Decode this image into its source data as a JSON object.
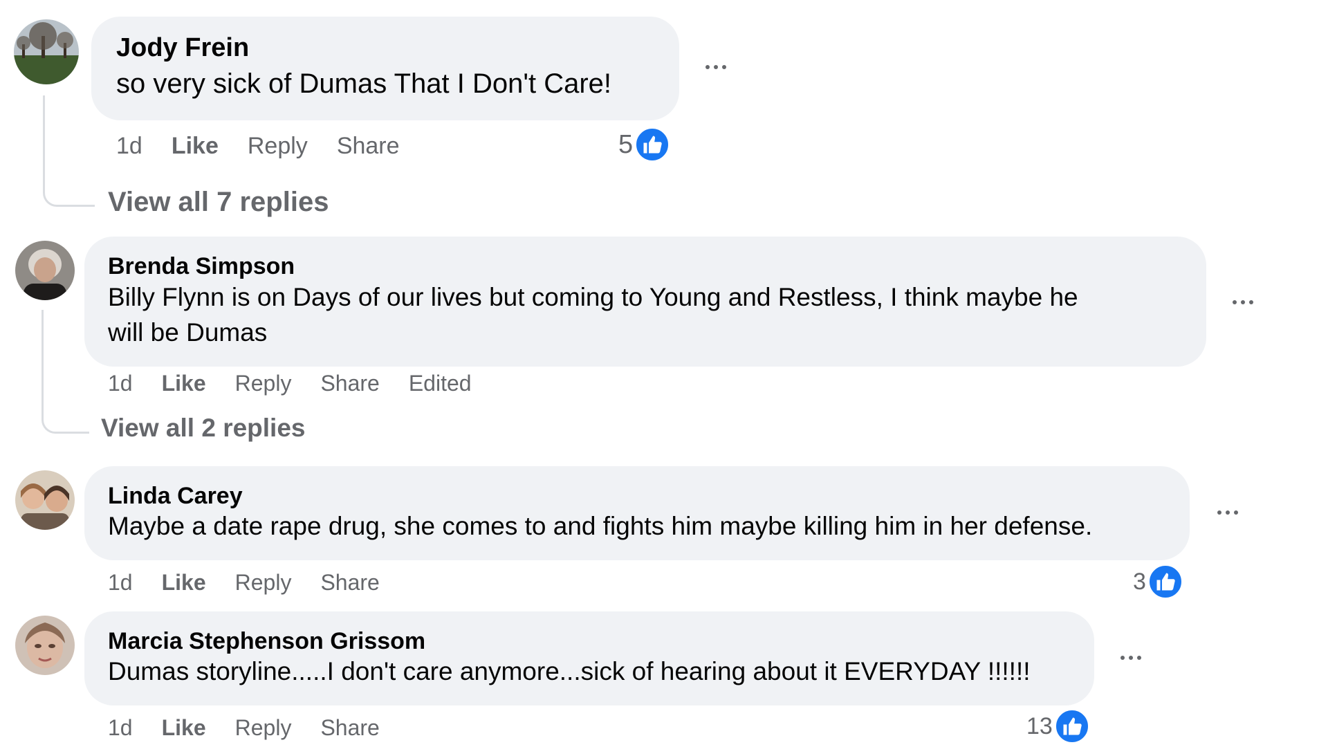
{
  "comments": [
    {
      "author": "Jody Frein",
      "text": "so very sick of Dumas That I Don't Care!",
      "time": "1d",
      "like": "Like",
      "reply": "Reply",
      "share": "Share",
      "reaction_count": "5",
      "view_replies": "View all 7 replies"
    },
    {
      "author": "Brenda Simpson",
      "text_line1": "Billy Flynn is on Days of our lives but coming to Young and Restless, I think maybe he",
      "text_line2": "will be Dumas",
      "time": "1d",
      "like": "Like",
      "reply": "Reply",
      "share": "Share",
      "edited": "Edited",
      "view_replies": "View all 2 replies"
    },
    {
      "author": "Linda Carey",
      "text": "Maybe a date rape drug, she comes to and fights him maybe killing him in her defense.",
      "time": "1d",
      "like": "Like",
      "reply": "Reply",
      "share": "Share",
      "reaction_count": "3"
    },
    {
      "author": "Marcia Stephenson Grissom",
      "text": "Dumas storyline.....I don't care anymore...sick of hearing about it EVERYDAY !!!!!!",
      "time": "1d",
      "like": "Like",
      "reply": "Reply",
      "share": "Share",
      "reaction_count": "13"
    }
  ],
  "icons": {
    "more": "more-options-icon",
    "reaction": "like-thumb-icon"
  },
  "colors": {
    "bubble": "#f0f2f5",
    "meta_text": "#65676b",
    "like_blue": "#1877f2",
    "thread_line": "#dadde1"
  }
}
